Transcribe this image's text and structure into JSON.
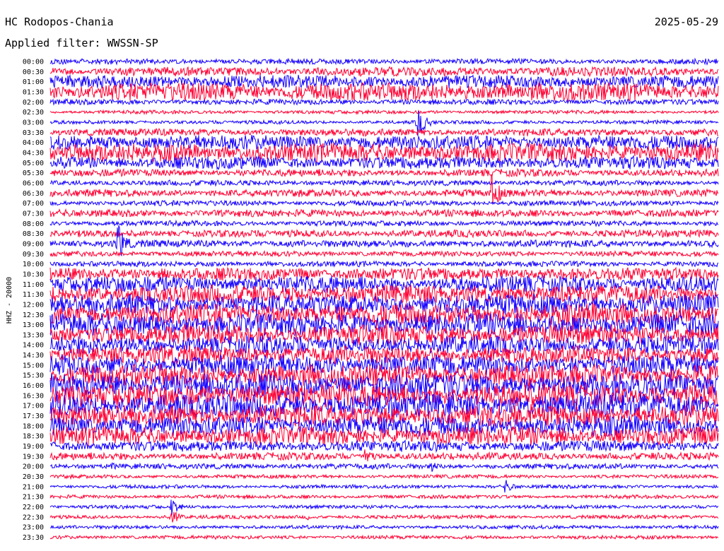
{
  "header": {
    "station": "HC Rodopos-Chania",
    "date": "2025-05-29",
    "filter": "Applied filter: WWSSN-SP"
  },
  "colors": {
    "blue": "#1400ff",
    "red": "#ff0033",
    "background": "#ffffff"
  },
  "chart_data": {
    "type": "line",
    "title": "HC Rodopos-Chania",
    "subtitle": "Applied filter: WWSSN-SP",
    "ylabel": "HHZ - 20000",
    "xlabel": "",
    "grid": false,
    "row_interval_minutes": 30,
    "row_labels": [
      "00:00",
      "00:30",
      "01:00",
      "01:30",
      "02:00",
      "02:30",
      "03:00",
      "03:30",
      "04:00",
      "04:30",
      "05:00",
      "05:30",
      "06:00",
      "06:30",
      "07:00",
      "07:30",
      "08:00",
      "08:30",
      "09:00",
      "09:30",
      "10:00",
      "10:30",
      "11:00",
      "11:30",
      "12:00",
      "12:30",
      "13:00",
      "13:30",
      "14:00",
      "14:30",
      "15:00",
      "15:30",
      "16:00",
      "16:30",
      "17:00",
      "17:30",
      "18:00",
      "18:30",
      "19:00",
      "19:30",
      "20:00",
      "20:30",
      "21:00",
      "21:30",
      "22:00",
      "22:30",
      "23:00",
      "23:30"
    ],
    "trace_colors": [
      "#1400ff",
      "#ff0033"
    ],
    "relative_noise_amplitude": [
      3,
      5,
      7,
      10,
      3,
      2,
      2,
      4,
      8,
      10,
      7,
      4,
      3,
      4,
      3,
      4,
      3,
      4,
      4,
      3,
      3,
      7,
      9,
      10,
      11,
      12,
      12,
      11,
      10,
      10,
      11,
      12,
      13,
      13,
      13,
      12,
      11,
      10,
      6,
      4,
      3,
      2,
      2,
      2,
      2,
      2,
      2,
      2
    ],
    "events": [
      {
        "row_label": "03:00",
        "x_fraction": 0.55,
        "relative_amplitude": 20
      },
      {
        "row_label": "06:30",
        "x_fraction": 0.66,
        "relative_amplitude": 25
      },
      {
        "row_label": "09:00",
        "x_fraction": 0.1,
        "relative_amplitude": 30
      },
      {
        "row_label": "19:30",
        "x_fraction": 0.47,
        "relative_amplitude": 14
      },
      {
        "row_label": "20:00",
        "x_fraction": 0.09,
        "relative_amplitude": 6
      },
      {
        "row_label": "20:00",
        "x_fraction": 0.57,
        "relative_amplitude": 9
      },
      {
        "row_label": "21:00",
        "x_fraction": 0.68,
        "relative_amplitude": 10
      },
      {
        "row_label": "22:00",
        "x_fraction": 0.18,
        "relative_amplitude": 13
      },
      {
        "row_label": "22:30",
        "x_fraction": 0.18,
        "relative_amplitude": 11
      },
      {
        "row_label": "22:30",
        "x_fraction": 0.38,
        "relative_amplitude": 6
      }
    ]
  }
}
